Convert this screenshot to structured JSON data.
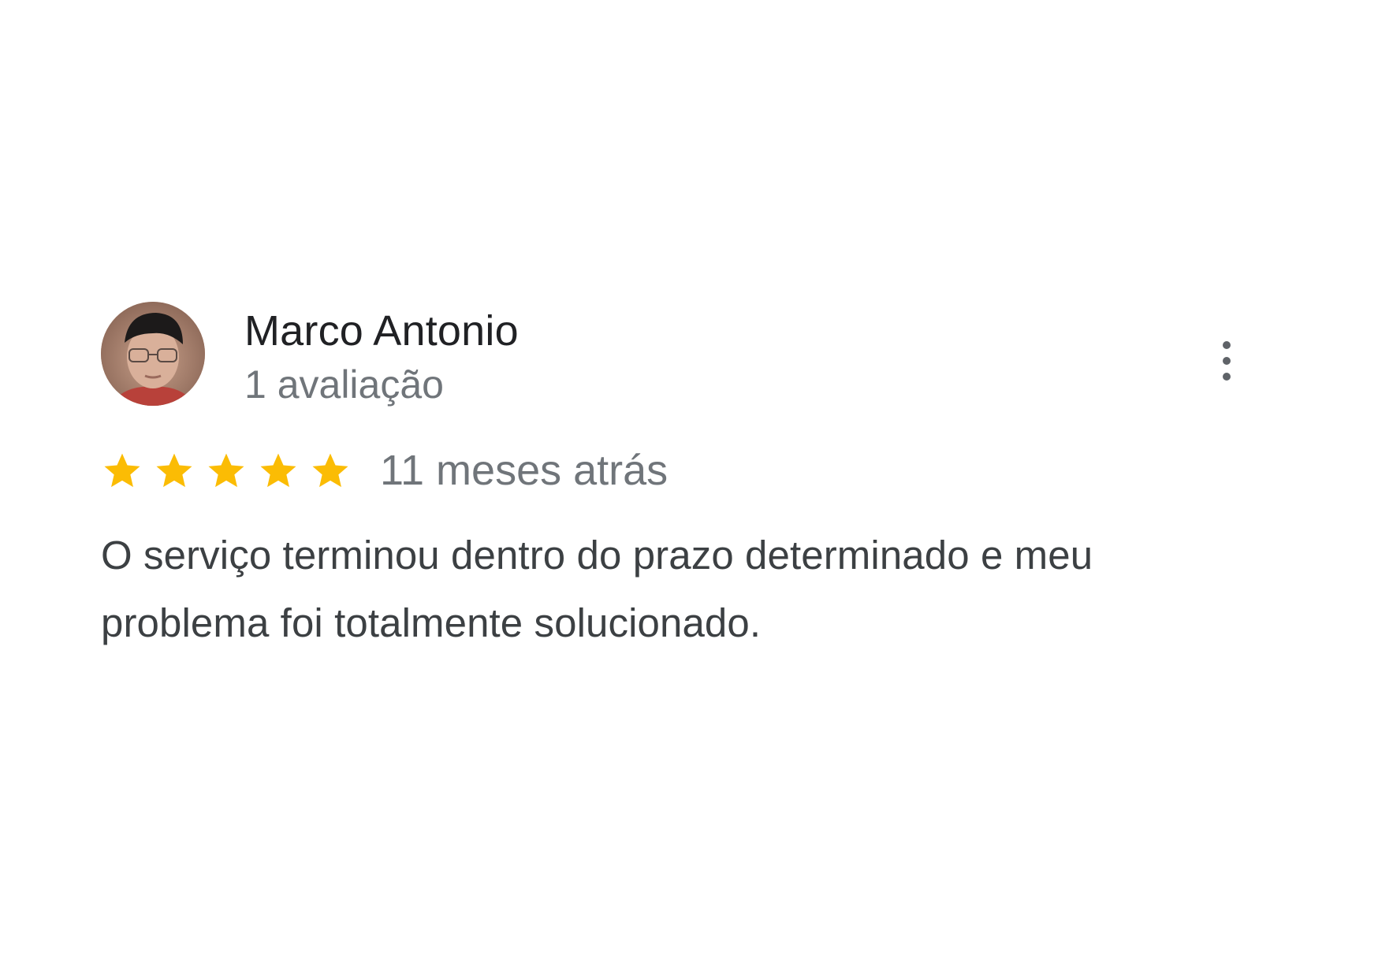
{
  "review": {
    "reviewer_name": "Marco Antonio",
    "review_count": "1 avaliação",
    "rating": 5,
    "rating_max": 5,
    "time_ago": "11 meses atrás",
    "text": "O serviço terminou dentro do prazo determinado e meu problema foi totalmente solucionado."
  },
  "icons": {
    "avatar": "reviewer-photo",
    "more": "more-vert-icon",
    "star": "star-icon"
  },
  "colors": {
    "star": "#fbbc04",
    "name": "#202124",
    "secondary": "#70757a",
    "body_text": "#3c4043"
  }
}
